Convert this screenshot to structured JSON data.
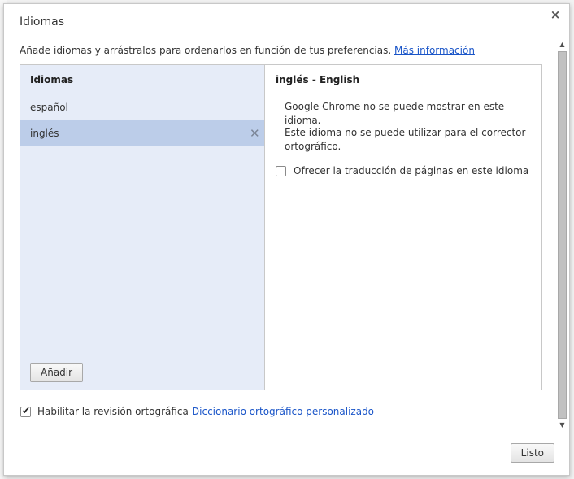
{
  "dialog": {
    "title": "Idiomas",
    "close_glyph": "×"
  },
  "intro": {
    "text": "Añade idiomas y arrástralos para ordenarlos en función de tus preferencias.",
    "link": "Más información"
  },
  "languages": {
    "header": "Idiomas",
    "items": [
      {
        "label": "español",
        "selected": false
      },
      {
        "label": "inglés",
        "selected": true
      }
    ],
    "remove_glyph": "✕",
    "add_button": "Añadir"
  },
  "detail": {
    "title": "inglés - English",
    "message_display": "Google Chrome no se puede mostrar en este idioma.",
    "message_spell": "Este idioma no se puede utilizar para el corrector ortográfico.",
    "offer_translate_label": "Ofrecer la traducción de páginas en este idioma",
    "offer_translate_checked": false
  },
  "spellcheck": {
    "label": "Habilitar la revisión ortográfica",
    "checked": true,
    "link": "Diccionario ortográfico personalizado"
  },
  "footer": {
    "done_button": "Listo"
  },
  "scrollbar": {
    "up_glyph": "▲",
    "down_glyph": "▼"
  },
  "colors": {
    "link": "#1a55c8",
    "left_pane_bg": "#e6ecf8",
    "selected_row": "#bccde9"
  }
}
